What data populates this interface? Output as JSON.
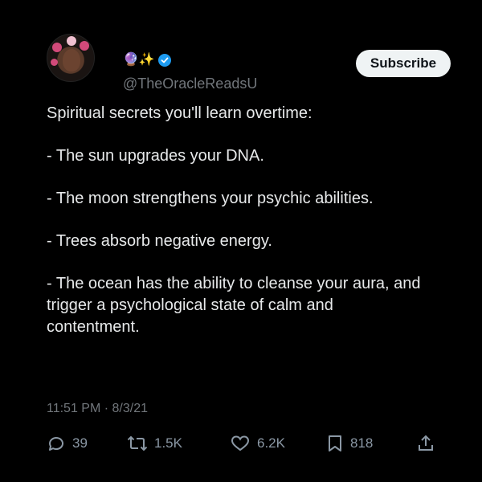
{
  "profile": {
    "name_emojis": "🔮✨",
    "handle": "@TheOracleReadsU"
  },
  "buttons": {
    "subscribe": "Subscribe"
  },
  "tweet": {
    "lines": [
      "Spiritual secrets you'll learn overtime:",
      "- The sun upgrades your DNA.",
      "- The moon strengthens your psychic abilities.",
      "- Trees absorb negative energy.",
      "- The ocean has the ability to cleanse your aura, and trigger a psychological state of calm and contentment."
    ],
    "timestamp": "11:51 PM · 8/3/21"
  },
  "stats": {
    "replies": "39",
    "retweets": "1.5K",
    "likes": "6.2K",
    "bookmarks": "818"
  },
  "colors": {
    "background": "#000000",
    "text": "#e7e9ea",
    "muted": "#71767b",
    "verified": "#1d9bf0"
  }
}
